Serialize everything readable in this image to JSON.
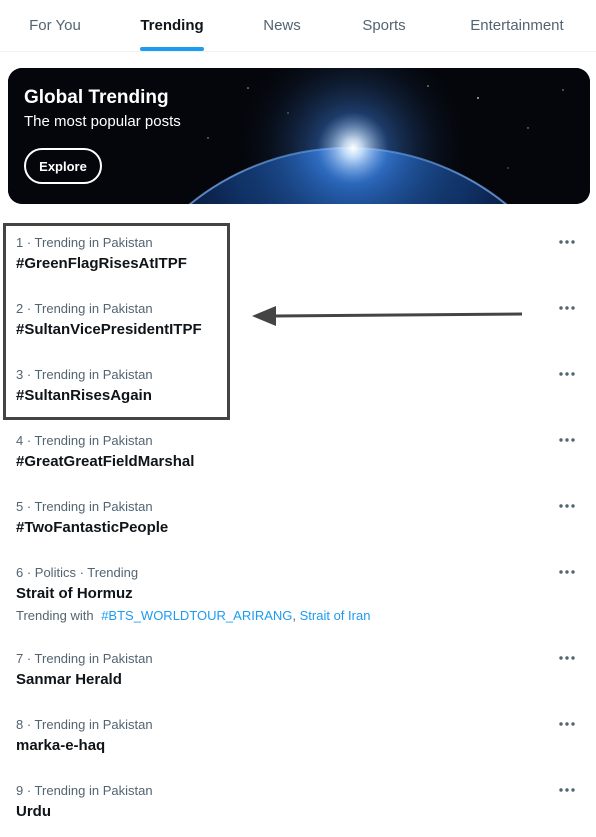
{
  "tabs": [
    {
      "label": "For You",
      "active": false
    },
    {
      "label": "Trending",
      "active": true
    },
    {
      "label": "News",
      "active": false
    },
    {
      "label": "Sports",
      "active": false
    },
    {
      "label": "Entertainment",
      "active": false
    }
  ],
  "banner": {
    "title": "Global Trending",
    "subtitle": "The most popular posts",
    "button_label": "Explore"
  },
  "trends": [
    {
      "meta": "1 · Trending in Pakistan",
      "title": "#GreenFlagRisesAtITPF"
    },
    {
      "meta": "2 · Trending in Pakistan",
      "title": "#SultanVicePresidentITPF"
    },
    {
      "meta": "3 · Trending in Pakistan",
      "title": "#SultanRisesAgain"
    },
    {
      "meta": "4 · Trending in Pakistan",
      "title": "#GreatGreatFieldMarshal"
    },
    {
      "meta": "5 · Trending in Pakistan",
      "title": "#TwoFantasticPeople"
    },
    {
      "meta": "6 · Politics · Trending",
      "title": "Strait of Hormuz",
      "trending_with": {
        "prefix": "Trending with",
        "links": [
          "#BTS_WORLDTOUR_ARIRANG",
          "Strait of Iran"
        ]
      }
    },
    {
      "meta": "7 · Trending in Pakistan",
      "title": "Sanmar Herald"
    },
    {
      "meta": "8 · Trending in Pakistan",
      "title": "marka-e-haq"
    },
    {
      "meta": "9 · Trending in Pakistan",
      "title": "Urdu"
    }
  ],
  "icons": {
    "more": "more-horizontal-icon"
  },
  "colors": {
    "accent": "#1d9bf0",
    "text": "#0f1419",
    "secondary": "#536471",
    "annotation": "#444444"
  }
}
